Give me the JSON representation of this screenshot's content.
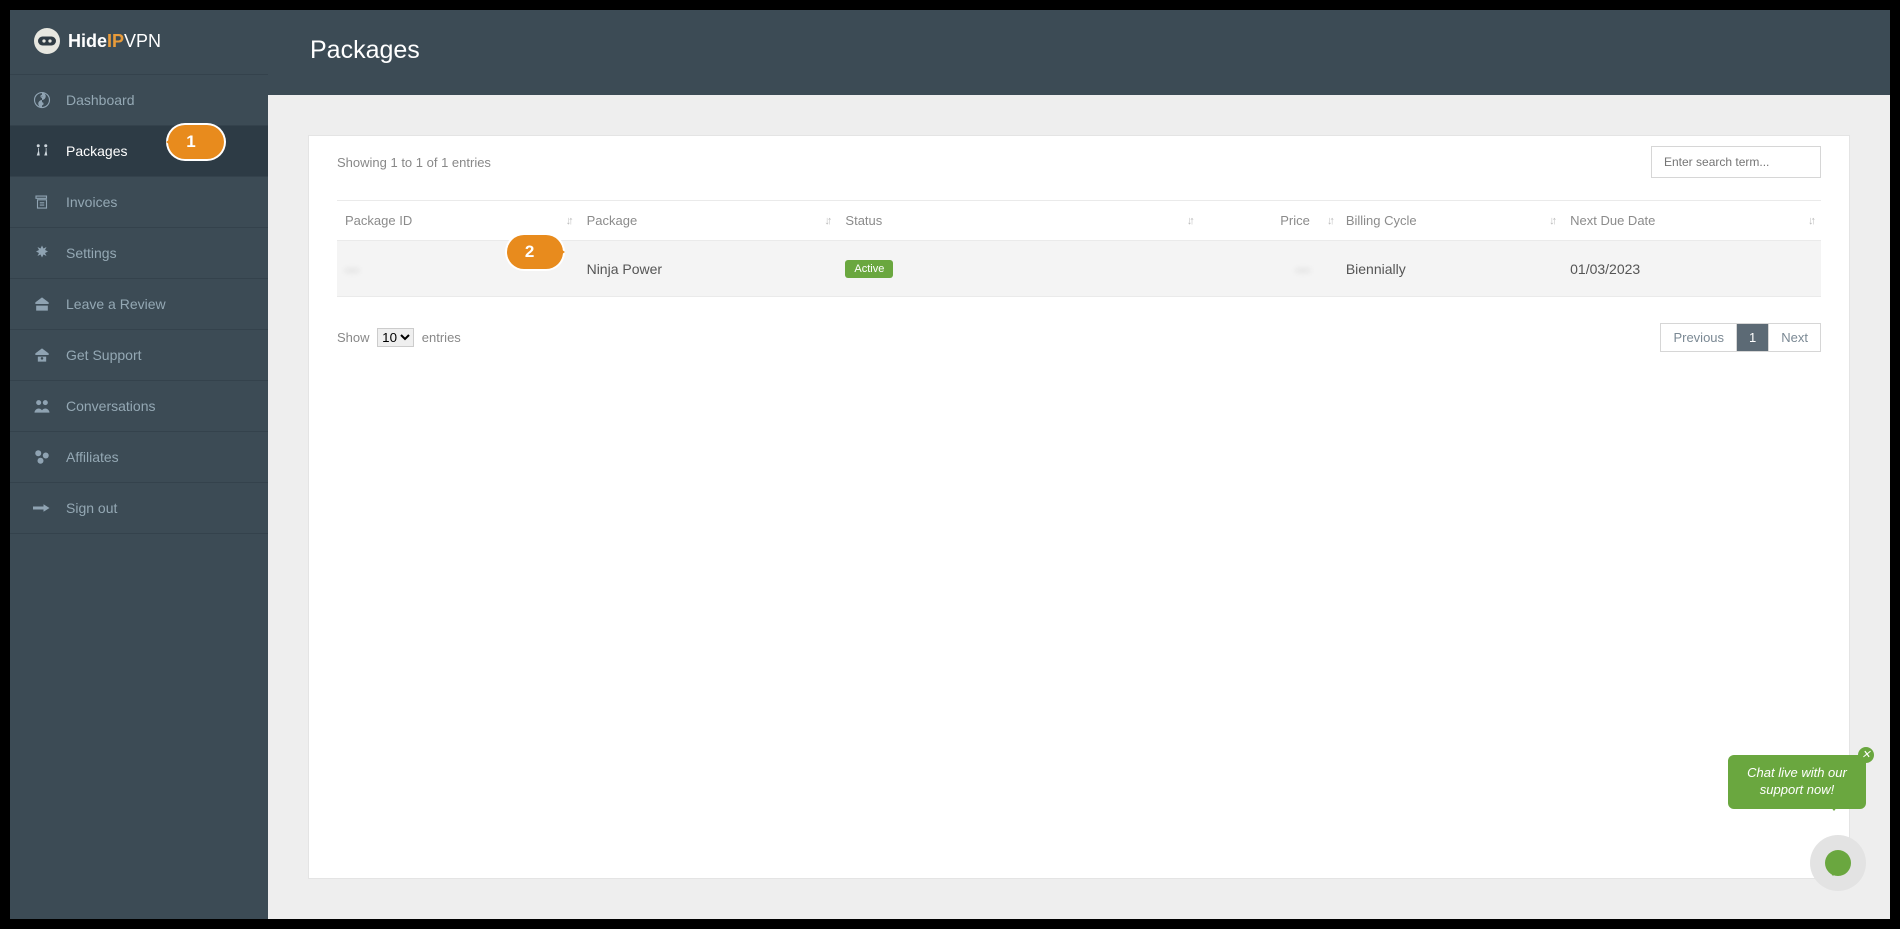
{
  "brand": {
    "text_a": "Hide",
    "text_b": "IP",
    "text_c": "VPN"
  },
  "sidebar": {
    "items": [
      {
        "label": "Dashboard"
      },
      {
        "label": "Packages"
      },
      {
        "label": "Invoices"
      },
      {
        "label": "Settings"
      },
      {
        "label": "Leave a Review"
      },
      {
        "label": "Get Support"
      },
      {
        "label": "Conversations"
      },
      {
        "label": "Affiliates"
      },
      {
        "label": "Sign out"
      }
    ]
  },
  "header": {
    "title": "Packages"
  },
  "table_info": "Showing 1 to 1 of 1 entries",
  "search": {
    "placeholder": "Enter search term..."
  },
  "columns": {
    "id": "Package ID",
    "pkg": "Package",
    "status": "Status",
    "price": "Price",
    "cycle": "Billing Cycle",
    "date": "Next Due Date"
  },
  "rows": [
    {
      "id": "—",
      "pkg": "Ninja Power",
      "status": "Active",
      "price": "—",
      "cycle": "Biennially",
      "date": "01/03/2023"
    }
  ],
  "footer": {
    "show": "Show",
    "entries": "entries",
    "select": "10"
  },
  "pager": {
    "prev": "Previous",
    "page": "1",
    "next": "Next"
  },
  "markers": {
    "m1": "1",
    "m2": "2"
  },
  "chat": {
    "tip": "Chat live with our support now!"
  }
}
